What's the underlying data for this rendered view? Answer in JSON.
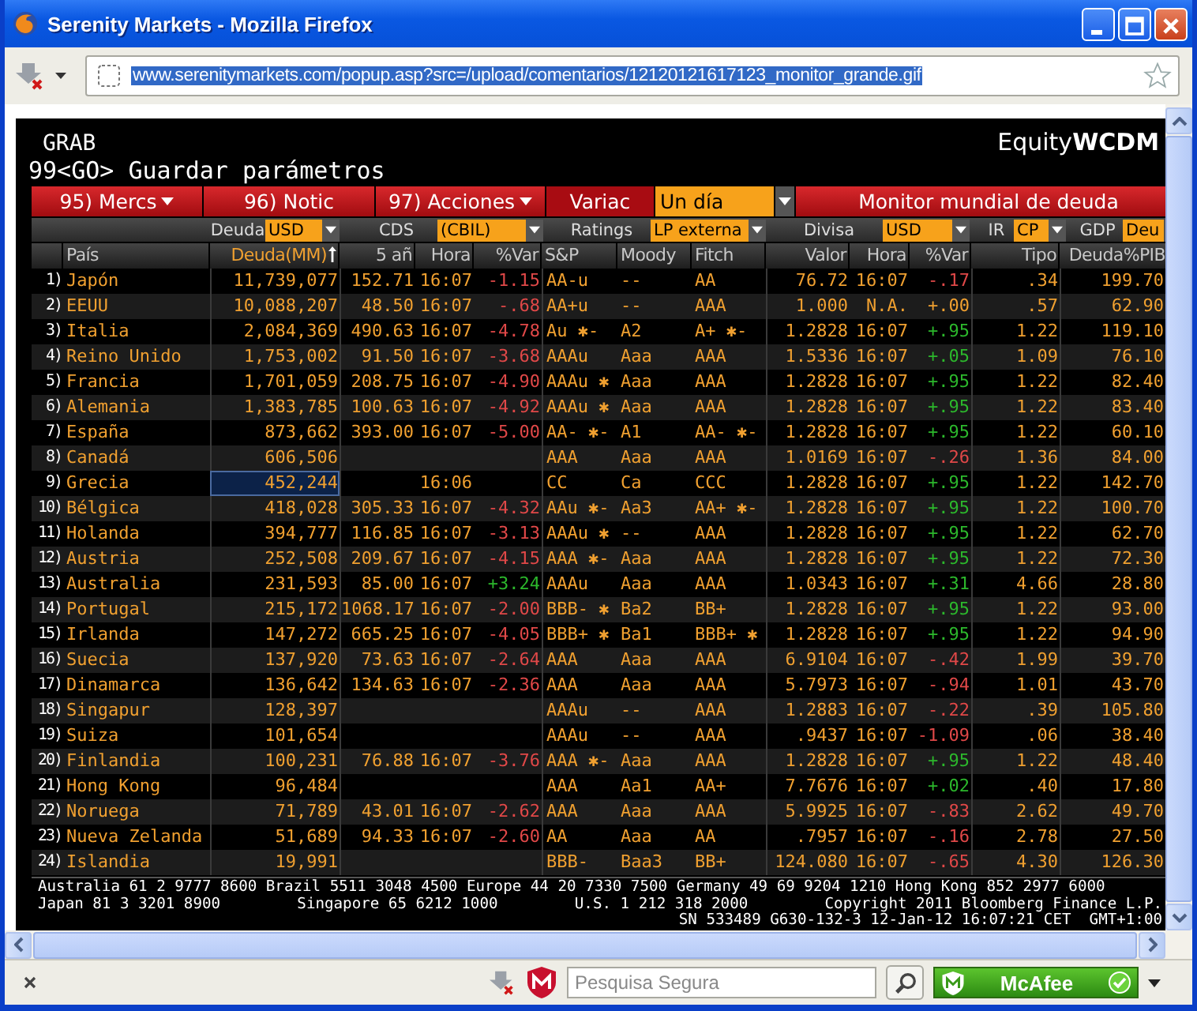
{
  "window": {
    "title": "Serenity Markets - Mozilla Firefox"
  },
  "address_bar": {
    "url": "www.serenitymarkets.com/popup.asp?src=/upload/comentarios/12120121617123_monitor_grande.gif"
  },
  "terminal": {
    "label": "GRAB",
    "brand": "Equity",
    "code": "WCDM",
    "command": "99<GO> Guardar parámetros",
    "toolbar": [
      {
        "kind": "menu",
        "label": "95) Mercs"
      },
      {
        "kind": "button",
        "label": "96) Notic"
      },
      {
        "kind": "menu",
        "label": "97) Acciones"
      },
      {
        "kind": "label",
        "label": "Variac"
      },
      {
        "kind": "select",
        "label": "Un día"
      },
      {
        "kind": "title",
        "label": "Monitor mundial de deuda"
      }
    ],
    "filters": [
      {
        "label": "Deuda",
        "value": "USD"
      },
      {
        "label": "CDS",
        "value": "(CBIL)"
      },
      {
        "label": "Ratings",
        "value": "LP externa"
      },
      {
        "label": "Divisa",
        "value": "USD"
      },
      {
        "label": "IR",
        "value": "CP"
      },
      {
        "label": "GDP",
        "value": "Deu"
      }
    ],
    "table": {
      "columns": [
        {
          "label": "País",
          "sorted": false
        },
        {
          "label": "Deuda(MM)",
          "sorted": true
        },
        {
          "label": "5 añ",
          "sorted": false
        },
        {
          "label": "Hora",
          "sorted": false
        },
        {
          "label": "%Var",
          "sorted": false
        },
        {
          "label": "S&P",
          "sorted": false
        },
        {
          "label": "Moody",
          "sorted": false
        },
        {
          "label": "Fitch",
          "sorted": false
        },
        {
          "label": "Valor",
          "sorted": false
        },
        {
          "label": "Hora",
          "sorted": false
        },
        {
          "label": "%Var",
          "sorted": false
        },
        {
          "label": "Tipo",
          "sorted": false
        },
        {
          "label": "Deuda%PIB",
          "sorted": false
        }
      ],
      "rows": [
        {
          "n": "1)",
          "country": "Japón",
          "debt": "11,739,077",
          "selected": false,
          "cds": "152.71",
          "cds_time": "16:07",
          "cds_chg": {
            "text": "-1.15",
            "color": "#e04848"
          },
          "sp": "AA-u",
          "moody": "--",
          "fitch": "AA",
          "fx": "76.72",
          "fx_time": "16:07",
          "fx_chg": {
            "text": "-.17",
            "color": "#e04848"
          },
          "rate": ".34",
          "debt_gdp": "199.70"
        },
        {
          "n": "2)",
          "country": "EEUU",
          "debt": "10,088,207",
          "selected": false,
          "cds": "48.50",
          "cds_time": "16:07",
          "cds_chg": {
            "text": "-.68",
            "color": "#e04848"
          },
          "sp": "AA+u",
          "moody": "--",
          "fitch": "AAA",
          "fx": "1.000",
          "fx_time": "N.A.",
          "fx_chg": {
            "text": "+.00",
            "color": "#f0a030"
          },
          "rate": ".57",
          "debt_gdp": "62.90"
        },
        {
          "n": "3)",
          "country": "Italia",
          "debt": "2,084,369",
          "selected": false,
          "cds": "490.63",
          "cds_time": "16:07",
          "cds_chg": {
            "text": "-4.78",
            "color": "#e04848"
          },
          "sp": "Au ✱-",
          "moody": "A2",
          "fitch": "A+ ✱-",
          "fx": "1.2828",
          "fx_time": "16:07",
          "fx_chg": {
            "text": "+.95",
            "color": "#2cb82c"
          },
          "rate": "1.22",
          "debt_gdp": "119.10"
        },
        {
          "n": "4)",
          "country": "Reino Unido",
          "debt": "1,753,002",
          "selected": false,
          "cds": "91.50",
          "cds_time": "16:07",
          "cds_chg": {
            "text": "-3.68",
            "color": "#e04848"
          },
          "sp": "AAAu",
          "moody": "Aaa",
          "fitch": "AAA",
          "fx": "1.5336",
          "fx_time": "16:07",
          "fx_chg": {
            "text": "+.05",
            "color": "#2cb82c"
          },
          "rate": "1.09",
          "debt_gdp": "76.10"
        },
        {
          "n": "5)",
          "country": "Francia",
          "debt": "1,701,059",
          "selected": false,
          "cds": "208.75",
          "cds_time": "16:07",
          "cds_chg": {
            "text": "-4.90",
            "color": "#e04848"
          },
          "sp": "AAAu ✱",
          "moody": "Aaa",
          "fitch": "AAA",
          "fx": "1.2828",
          "fx_time": "16:07",
          "fx_chg": {
            "text": "+.95",
            "color": "#2cb82c"
          },
          "rate": "1.22",
          "debt_gdp": "82.40"
        },
        {
          "n": "6)",
          "country": "Alemania",
          "debt": "1,383,785",
          "selected": false,
          "cds": "100.63",
          "cds_time": "16:07",
          "cds_chg": {
            "text": "-4.92",
            "color": "#e04848"
          },
          "sp": "AAAu ✱",
          "moody": "Aaa",
          "fitch": "AAA",
          "fx": "1.2828",
          "fx_time": "16:07",
          "fx_chg": {
            "text": "+.95",
            "color": "#2cb82c"
          },
          "rate": "1.22",
          "debt_gdp": "83.40"
        },
        {
          "n": "7)",
          "country": "España",
          "debt": "873,662",
          "selected": false,
          "cds": "393.00",
          "cds_time": "16:07",
          "cds_chg": {
            "text": "-5.00",
            "color": "#e04848"
          },
          "sp": "AA- ✱-",
          "moody": "A1",
          "fitch": "AA- ✱-",
          "fx": "1.2828",
          "fx_time": "16:07",
          "fx_chg": {
            "text": "+.95",
            "color": "#2cb82c"
          },
          "rate": "1.22",
          "debt_gdp": "60.10"
        },
        {
          "n": "8)",
          "country": "Canadá",
          "debt": "606,506",
          "selected": false,
          "sp": "AAA",
          "moody": "Aaa",
          "fitch": "AAA",
          "fx": "1.0169",
          "fx_time": "16:07",
          "fx_chg": {
            "text": "-.26",
            "color": "#e04848"
          },
          "rate": "1.36",
          "debt_gdp": "84.00"
        },
        {
          "n": "9)",
          "country": "Grecia",
          "debt": "452,244",
          "selected": true,
          "cds_time": "16:06",
          "sp": "CC",
          "moody": "Ca",
          "fitch": "CCC",
          "fx": "1.2828",
          "fx_time": "16:07",
          "fx_chg": {
            "text": "+.95",
            "color": "#2cb82c"
          },
          "rate": "1.22",
          "debt_gdp": "142.70"
        },
        {
          "n": "10)",
          "country": "Bélgica",
          "debt": "418,028",
          "selected": false,
          "cds": "305.33",
          "cds_time": "16:07",
          "cds_chg": {
            "text": "-4.32",
            "color": "#e04848"
          },
          "sp": "AAu ✱-",
          "moody": "Aa3",
          "fitch": "AA+ ✱-",
          "fx": "1.2828",
          "fx_time": "16:07",
          "fx_chg": {
            "text": "+.95",
            "color": "#2cb82c"
          },
          "rate": "1.22",
          "debt_gdp": "100.70"
        },
        {
          "n": "11)",
          "country": "Holanda",
          "debt": "394,777",
          "selected": false,
          "cds": "116.85",
          "cds_time": "16:07",
          "cds_chg": {
            "text": "-3.13",
            "color": "#e04848"
          },
          "sp": "AAAu ✱",
          "moody": "--",
          "fitch": "AAA",
          "fx": "1.2828",
          "fx_time": "16:07",
          "fx_chg": {
            "text": "+.95",
            "color": "#2cb82c"
          },
          "rate": "1.22",
          "debt_gdp": "62.70"
        },
        {
          "n": "12)",
          "country": "Austria",
          "debt": "252,508",
          "selected": false,
          "cds": "209.67",
          "cds_time": "16:07",
          "cds_chg": {
            "text": "-4.15",
            "color": "#e04848"
          },
          "sp": "AAA ✱-",
          "moody": "Aaa",
          "fitch": "AAA",
          "fx": "1.2828",
          "fx_time": "16:07",
          "fx_chg": {
            "text": "+.95",
            "color": "#2cb82c"
          },
          "rate": "1.22",
          "debt_gdp": "72.30"
        },
        {
          "n": "13)",
          "country": "Australia",
          "debt": "231,593",
          "selected": false,
          "cds": "85.00",
          "cds_time": "16:07",
          "cds_chg": {
            "text": "+3.24",
            "color": "#2cb82c"
          },
          "sp": "AAAu",
          "moody": "Aaa",
          "fitch": "AAA",
          "fx": "1.0343",
          "fx_time": "16:07",
          "fx_chg": {
            "text": "+.31",
            "color": "#2cb82c"
          },
          "rate": "4.66",
          "debt_gdp": "28.80"
        },
        {
          "n": "14)",
          "country": "Portugal",
          "debt": "215,172",
          "selected": false,
          "cds": "1068.17",
          "cds_time": "16:07",
          "cds_chg": {
            "text": "-2.00",
            "color": "#e04848"
          },
          "sp": "BBB- ✱",
          "moody": "Ba2",
          "fitch": "BB+",
          "fx": "1.2828",
          "fx_time": "16:07",
          "fx_chg": {
            "text": "+.95",
            "color": "#2cb82c"
          },
          "rate": "1.22",
          "debt_gdp": "93.00"
        },
        {
          "n": "15)",
          "country": "Irlanda",
          "debt": "147,272",
          "selected": false,
          "cds": "665.25",
          "cds_time": "16:07",
          "cds_chg": {
            "text": "-4.05",
            "color": "#e04848"
          },
          "sp": "BBB+ ✱",
          "moody": "Ba1",
          "fitch": "BBB+ ✱",
          "fx": "1.2828",
          "fx_time": "16:07",
          "fx_chg": {
            "text": "+.95",
            "color": "#2cb82c"
          },
          "rate": "1.22",
          "debt_gdp": "94.90"
        },
        {
          "n": "16)",
          "country": "Suecia",
          "debt": "137,920",
          "selected": false,
          "cds": "73.63",
          "cds_time": "16:07",
          "cds_chg": {
            "text": "-2.64",
            "color": "#e04848"
          },
          "sp": "AAA",
          "moody": "Aaa",
          "fitch": "AAA",
          "fx": "6.9104",
          "fx_time": "16:07",
          "fx_chg": {
            "text": "-.42",
            "color": "#e04848"
          },
          "rate": "1.99",
          "debt_gdp": "39.70"
        },
        {
          "n": "17)",
          "country": "Dinamarca",
          "debt": "136,642",
          "selected": false,
          "cds": "134.63",
          "cds_time": "16:07",
          "cds_chg": {
            "text": "-2.36",
            "color": "#e04848"
          },
          "sp": "AAA",
          "moody": "Aaa",
          "fitch": "AAA",
          "fx": "5.7973",
          "fx_time": "16:07",
          "fx_chg": {
            "text": "-.94",
            "color": "#e04848"
          },
          "rate": "1.01",
          "debt_gdp": "43.70"
        },
        {
          "n": "18)",
          "country": "Singapur",
          "debt": "128,397",
          "selected": false,
          "sp": "AAAu",
          "moody": "--",
          "fitch": "AAA",
          "fx": "1.2883",
          "fx_time": "16:07",
          "fx_chg": {
            "text": "-.22",
            "color": "#e04848"
          },
          "rate": ".39",
          "debt_gdp": "105.80"
        },
        {
          "n": "19)",
          "country": "Suiza",
          "debt": "101,654",
          "selected": false,
          "sp": "AAAu",
          "moody": "--",
          "fitch": "AAA",
          "fx": ".9437",
          "fx_time": "16:07",
          "fx_chg": {
            "text": "-1.09",
            "color": "#e04848"
          },
          "rate": ".06",
          "debt_gdp": "38.40"
        },
        {
          "n": "20)",
          "country": "Finlandia",
          "debt": "100,231",
          "selected": false,
          "cds": "76.88",
          "cds_time": "16:07",
          "cds_chg": {
            "text": "-3.76",
            "color": "#e04848"
          },
          "sp": "AAA ✱-",
          "moody": "Aaa",
          "fitch": "AAA",
          "fx": "1.2828",
          "fx_time": "16:07",
          "fx_chg": {
            "text": "+.95",
            "color": "#2cb82c"
          },
          "rate": "1.22",
          "debt_gdp": "48.40"
        },
        {
          "n": "21)",
          "country": "Hong Kong",
          "debt": "96,484",
          "selected": false,
          "sp": "AAA",
          "moody": "Aa1",
          "fitch": "AA+",
          "fx": "7.7676",
          "fx_time": "16:07",
          "fx_chg": {
            "text": "+.02",
            "color": "#2cb82c"
          },
          "rate": ".40",
          "debt_gdp": "17.80"
        },
        {
          "n": "22)",
          "country": "Noruega",
          "debt": "71,789",
          "selected": false,
          "cds": "43.01",
          "cds_time": "16:07",
          "cds_chg": {
            "text": "-2.62",
            "color": "#e04848"
          },
          "sp": "AAA",
          "moody": "Aaa",
          "fitch": "AAA",
          "fx": "5.9925",
          "fx_time": "16:07",
          "fx_chg": {
            "text": "-.83",
            "color": "#e04848"
          },
          "rate": "2.62",
          "debt_gdp": "49.70"
        },
        {
          "n": "23)",
          "country": "Nueva Zelanda",
          "debt": "51,689",
          "selected": false,
          "cds": "94.33",
          "cds_time": "16:07",
          "cds_chg": {
            "text": "-2.60",
            "color": "#e04848"
          },
          "sp": "AA",
          "moody": "Aaa",
          "fitch": "AA",
          "fx": ".7957",
          "fx_time": "16:07",
          "fx_chg": {
            "text": "-.16",
            "color": "#e04848"
          },
          "rate": "2.78",
          "debt_gdp": "27.50"
        },
        {
          "n": "24)",
          "country": "Islandia",
          "debt": "19,991",
          "selected": false,
          "sp": "BBB-",
          "moody": "Baa3",
          "fitch": "BB+",
          "fx": "124.080",
          "fx_time": "16:07",
          "fx_chg": {
            "text": "-.65",
            "color": "#e04848"
          },
          "rate": "4.30",
          "debt_gdp": "126.30"
        }
      ]
    },
    "footer": [
      [
        "Australia 61 2 9777 8600 Brazil 5511 3048 4500 Europe 44 20 7330 7500 Germany 49 69 9204 1210 Hong Kong 852 2977 6000"
      ],
      [
        "Japan 81 3 3201 8900",
        "Singapore 65 6212 1000",
        "U.S. 1 212 318 2000",
        "Copyright 2011 Bloomberg Finance L.P."
      ],
      [
        "SN 533489 G630-132-3 12-Jan-12 16:07:21 CET  GMT+1:00"
      ]
    ]
  },
  "status_bar": {
    "search_placeholder": "Pesquisa Segura",
    "addon_label": "McAfee"
  }
}
